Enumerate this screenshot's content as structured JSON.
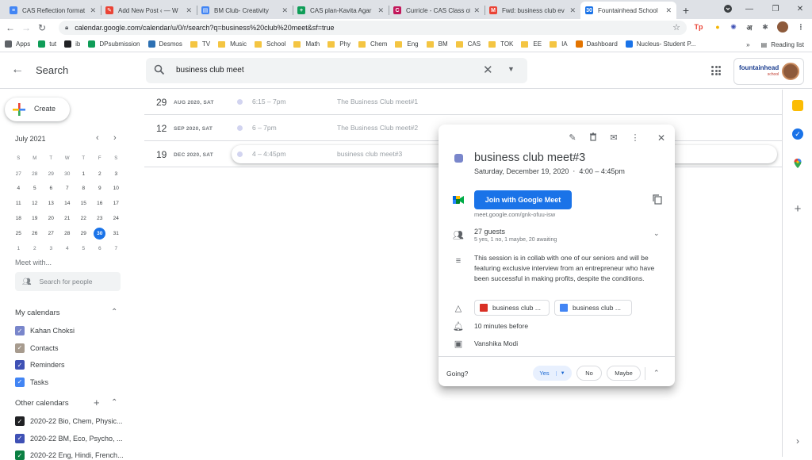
{
  "tabs": [
    {
      "title": "CAS Reflection format",
      "favcolor": "#4285f4",
      "favtext": "≡"
    },
    {
      "title": "Add New Post ‹ — W",
      "favcolor": "#ea4335",
      "favtext": "✎"
    },
    {
      "title": "BM Club- Creativity",
      "favcolor": "#4285f4",
      "favtext": "▤"
    },
    {
      "title": "CAS plan-Kavita Agar",
      "favcolor": "#0f9d58",
      "favtext": "+"
    },
    {
      "title": "Curricle - CAS Class of",
      "favcolor": "#c2185b",
      "favtext": "C"
    },
    {
      "title": "Fwd: business club ev",
      "favcolor": "#ea4335",
      "favtext": "M"
    },
    {
      "title": "Fountainhead School",
      "favcolor": "#1a73e8",
      "favtext": "30",
      "active": true
    }
  ],
  "browser": {
    "url": "calendar.google.com/calendar/u/0/r/search?q=business%20club%20meet&sf=true",
    "bookmarks": [
      {
        "label": "Apps",
        "kind": "grid"
      },
      {
        "label": "tut",
        "kind": "green"
      },
      {
        "label": "ib",
        "kind": "ib"
      },
      {
        "label": "DPsubmission",
        "kind": "plus"
      },
      {
        "label": "Desmos",
        "kind": "desmos"
      },
      {
        "label": "TV",
        "kind": "folder"
      },
      {
        "label": "Music",
        "kind": "folder"
      },
      {
        "label": "School",
        "kind": "folder"
      },
      {
        "label": "Math",
        "kind": "folder"
      },
      {
        "label": "Phy",
        "kind": "folder"
      },
      {
        "label": "Chem",
        "kind": "folder"
      },
      {
        "label": "Eng",
        "kind": "folder"
      },
      {
        "label": "BM",
        "kind": "folder"
      },
      {
        "label": "CAS",
        "kind": "folder"
      },
      {
        "label": "TOK",
        "kind": "folder"
      },
      {
        "label": "EE",
        "kind": "folder"
      },
      {
        "label": "IA",
        "kind": "folder"
      },
      {
        "label": "Dashboard",
        "kind": "dash"
      },
      {
        "label": "Nucleus- Student P...",
        "kind": "nucleus"
      }
    ],
    "overflow": "»",
    "reading_list": "Reading list"
  },
  "header": {
    "title": "Search",
    "query": "business club meet",
    "brand_logo": "fountainhead",
    "brand_sub": "school"
  },
  "sidebar": {
    "create_label": "Create",
    "month_title": "July 2021",
    "weekday_heads": [
      "S",
      "M",
      "T",
      "W",
      "T",
      "F",
      "S"
    ],
    "days": [
      [
        "27",
        "28",
        "29",
        "30",
        "1",
        "2",
        "3"
      ],
      [
        "4",
        "5",
        "6",
        "7",
        "8",
        "9",
        "10"
      ],
      [
        "11",
        "12",
        "13",
        "14",
        "15",
        "16",
        "17"
      ],
      [
        "18",
        "19",
        "20",
        "21",
        "22",
        "23",
        "24"
      ],
      [
        "25",
        "26",
        "27",
        "28",
        "29",
        "30",
        "31"
      ],
      [
        "1",
        "2",
        "3",
        "4",
        "5",
        "6",
        "7"
      ]
    ],
    "today": "30",
    "meet_with": "Meet with...",
    "people_placeholder": "Search for people",
    "my_calendars_title": "My calendars",
    "my_calendars": [
      {
        "name": "Kahan Choksi",
        "color": "#7986cb"
      },
      {
        "name": "Contacts",
        "color": "#a79b8e"
      },
      {
        "name": "Reminders",
        "color": "#3f51b5"
      },
      {
        "name": "Tasks",
        "color": "#4285f4"
      }
    ],
    "other_calendars_title": "Other calendars",
    "other_calendars": [
      {
        "name": "2020-22 Bio, Chem, Physic...",
        "color": "#202124"
      },
      {
        "name": "2020-22 BM, Eco, Psycho, ...",
        "color": "#3f51b5"
      },
      {
        "name": "2020-22 Eng, Hindi, French...",
        "color": "#0b8043"
      }
    ]
  },
  "results": [
    {
      "day": "29",
      "month": "AUG 2020, SAT",
      "time": "6:15 – 7pm",
      "name": "The Business Club meet#1"
    },
    {
      "day": "12",
      "month": "SEP 2020, SAT",
      "time": "6 – 7pm",
      "name": "The Business Club meet#2"
    },
    {
      "day": "19",
      "month": "DEC 2020, SAT",
      "time": "4 – 4:45pm",
      "name": "business club meet#3",
      "selected": true
    }
  ],
  "event": {
    "title": "business club meet#3",
    "date": "Saturday, December 19, 2020",
    "sep": "⋅",
    "time": "4:00 – 4:45pm",
    "color": "#7986cb",
    "join_label": "Join with Google Meet",
    "meet_link": "meet.google.com/gnk-ofuu-isw",
    "guests": "27 guests",
    "guests_summary": "5 yes, 1 no, 1 maybe, 20 awaiting",
    "description": "This session is in collab with one of our seniors and  will be featuring exclusive interview from an entrepreneur who have been successful in making profits, despite the conditions.",
    "attachments": [
      {
        "label": "business club ...",
        "kind": "video"
      },
      {
        "label": "business club ...",
        "kind": "doc"
      }
    ],
    "reminder": "10 minutes before",
    "organizer": "Vanshika Modi",
    "going_label": "Going?",
    "rsvp": {
      "yes": "Yes",
      "no": "No",
      "maybe": "Maybe"
    }
  }
}
